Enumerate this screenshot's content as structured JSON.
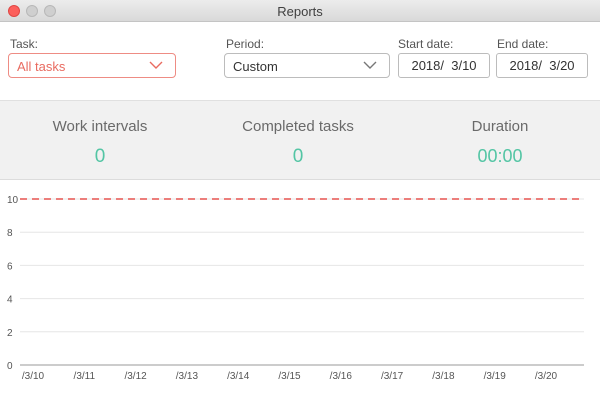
{
  "window": {
    "title": "Reports"
  },
  "filters": {
    "task_label": "Task:",
    "task_value": "All tasks",
    "period_label": "Period:",
    "period_value": "Custom",
    "start_label": "Start date:",
    "start_value": "2018/  3/10",
    "end_label": "End date:",
    "end_value": "2018/  3/20"
  },
  "stats": {
    "work_intervals_label": "Work intervals",
    "work_intervals_value": "0",
    "completed_tasks_label": "Completed tasks",
    "completed_tasks_value": "0",
    "duration_label": "Duration",
    "duration_value": "00:00"
  },
  "colors": {
    "accent_red": "#e96b60",
    "accent_green": "#53c5a4",
    "goal_line": "#e0302c"
  },
  "chart_data": {
    "type": "bar",
    "categories": [
      "/3/10",
      "/3/11",
      "/3/12",
      "/3/13",
      "/3/14",
      "/3/15",
      "/3/16",
      "/3/17",
      "/3/18",
      "/3/19",
      "/3/20"
    ],
    "values": [
      0,
      0,
      0,
      0,
      0,
      0,
      0,
      0,
      0,
      0,
      0
    ],
    "yticks": [
      0,
      2,
      4,
      6,
      8,
      10
    ],
    "ylim": [
      0,
      10
    ],
    "goal_line_value": 10,
    "grid": true
  }
}
